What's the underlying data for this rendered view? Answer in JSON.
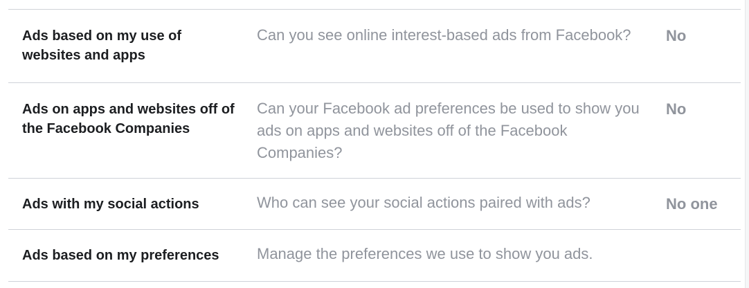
{
  "settings": {
    "rows": [
      {
        "label": "Ads based on my use of websites and apps",
        "description": "Can you see online interest-based ads from Facebook?",
        "value": "No"
      },
      {
        "label": "Ads on apps and websites off of the Facebook Companies",
        "description": "Can your Facebook ad preferences be used to show you ads on apps and websites off of the Facebook Companies?",
        "value": "No"
      },
      {
        "label": "Ads with my social actions",
        "description": "Who can see your social actions paired with ads?",
        "value": "No one"
      },
      {
        "label": "Ads based on my preferences",
        "description": "Manage the preferences we use to show you ads.",
        "value": ""
      }
    ]
  },
  "colors": {
    "label_text": "#1c1e21",
    "muted_text": "#90949c",
    "divider": "#cfd2d8"
  }
}
